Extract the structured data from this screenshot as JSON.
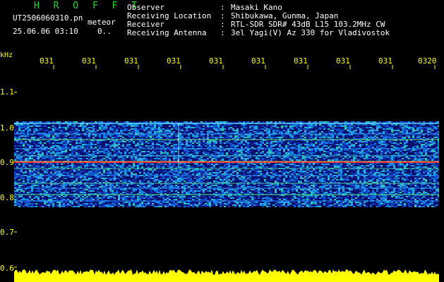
{
  "header": {
    "title": "H R O F F T",
    "filename": "UT2506060310.pn",
    "mode": "meteor",
    "datetime": "25.06.06 03:10",
    "indicator": "0.."
  },
  "info": [
    {
      "label": "Observer",
      "colon": ":",
      "value": "Masaki Kano"
    },
    {
      "label": "Receiving Location",
      "colon": ":",
      "value": "Shibukawa, Gunma, Japan"
    },
    {
      "label": "Receiver",
      "colon": ":",
      "value": "RTL-SDR SDR# 43dB L15 103.2MHz CW"
    },
    {
      "label": "Receiving Antenna",
      "colon": ":",
      "value": "3el Yagi(V) Az 330 for Vladivostok"
    }
  ],
  "axis": {
    "unit": "kHz",
    "time_ticks": [
      "031",
      "031",
      "031",
      "031",
      "031",
      "031",
      "031",
      "031",
      "031",
      "0320"
    ],
    "freq_ticks": [
      "1.1",
      "1.0",
      "0.9",
      "0.8",
      "0.7",
      "0.6"
    ]
  },
  "colors": {
    "text": "#ffffff",
    "title": "#1fe31f",
    "axis": "#ffff00",
    "signal_band": "#ff3030",
    "background_noise": "#0a1a8c",
    "amplitude": "#ffff00"
  }
}
